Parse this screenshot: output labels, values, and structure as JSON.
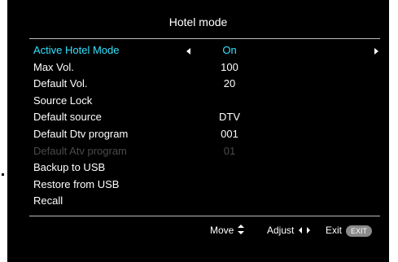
{
  "osd": {
    "title": "Hotel mode"
  },
  "menu": {
    "items": [
      {
        "label": "Active Hotel Mode",
        "value": "On",
        "state": "selected"
      },
      {
        "label": "Max Vol.",
        "value": "100",
        "state": "normal"
      },
      {
        "label": "Default Vol.",
        "value": "20",
        "state": "normal"
      },
      {
        "label": "Source Lock",
        "value": "",
        "state": "normal"
      },
      {
        "label": "Default source",
        "value": "DTV",
        "state": "normal"
      },
      {
        "label": "Default Dtv program",
        "value": "001",
        "state": "normal"
      },
      {
        "label": "Default Atv program",
        "value": "01",
        "state": "disabled"
      },
      {
        "label": "Backup to USB",
        "value": "",
        "state": "normal"
      },
      {
        "label": "Restore from USB",
        "value": "",
        "state": "normal"
      },
      {
        "label": "Recall",
        "value": "",
        "state": "normal"
      }
    ]
  },
  "footer": {
    "move_label": "Move",
    "move_icon": "up-down-arrows-icon",
    "adjust_label": "Adjust",
    "adjust_icon": "left-right-arrows-icon",
    "exit_label": "Exit",
    "exit_badge": "EXIT"
  },
  "colors": {
    "background": "#000000",
    "text": "#ffffff",
    "highlight": "#34e3ff",
    "disabled": "#4a4a4a",
    "rule": "#bcbcbc",
    "exit_badge": "#8a8a8a"
  }
}
